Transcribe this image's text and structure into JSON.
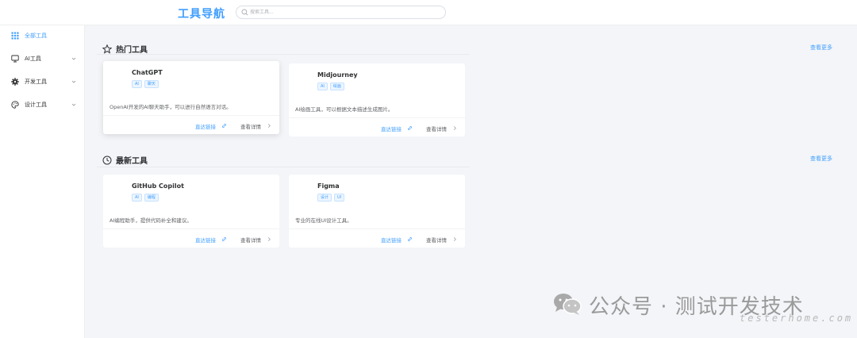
{
  "header": {
    "brand": "工具导航",
    "search_placeholder": "搜索工具..."
  },
  "sidebar": {
    "items": [
      {
        "label": "全部工具",
        "icon": "grid-icon",
        "active": true
      },
      {
        "label": "AI工具",
        "icon": "monitor-icon",
        "expandable": true
      },
      {
        "label": "开发工具",
        "icon": "gear-icon",
        "expandable": true
      },
      {
        "label": "设计工具",
        "icon": "palette-icon",
        "expandable": true
      }
    ]
  },
  "sections": {
    "hot": {
      "title": "热门工具",
      "icon": "star-icon",
      "more": "查看更多",
      "cards": [
        {
          "name": "ChatGPT",
          "tags": [
            "AI",
            "聊天"
          ],
          "desc": "OpenAI开发的AI聊天助手，可以进行自然语言对话。",
          "link": "直达链接",
          "detail": "查看详情"
        },
        {
          "name": "Midjourney",
          "tags": [
            "AI",
            "绘画"
          ],
          "desc": "AI绘画工具，可以根据文本描述生成图片。",
          "link": "直达链接",
          "detail": "查看详情"
        }
      ]
    },
    "new": {
      "title": "最新工具",
      "icon": "clock-icon",
      "more": "查看更多",
      "cards": [
        {
          "name": "GitHub Copilot",
          "tags": [
            "AI",
            "编程"
          ],
          "desc": "AI编程助手，提供代码补全和建议。",
          "link": "直达链接",
          "detail": "查看详情"
        },
        {
          "name": "Figma",
          "tags": [
            "设计",
            "UI"
          ],
          "desc": "专业的在线UI设计工具。",
          "link": "直达链接",
          "detail": "查看详情"
        }
      ]
    }
  },
  "watermark": {
    "text": "公众号 · 测试开发技术",
    "sub": "testerhome.com"
  },
  "colors": {
    "accent": "#409eff",
    "main_bg": "#f3f5f8",
    "text": "#303133"
  }
}
